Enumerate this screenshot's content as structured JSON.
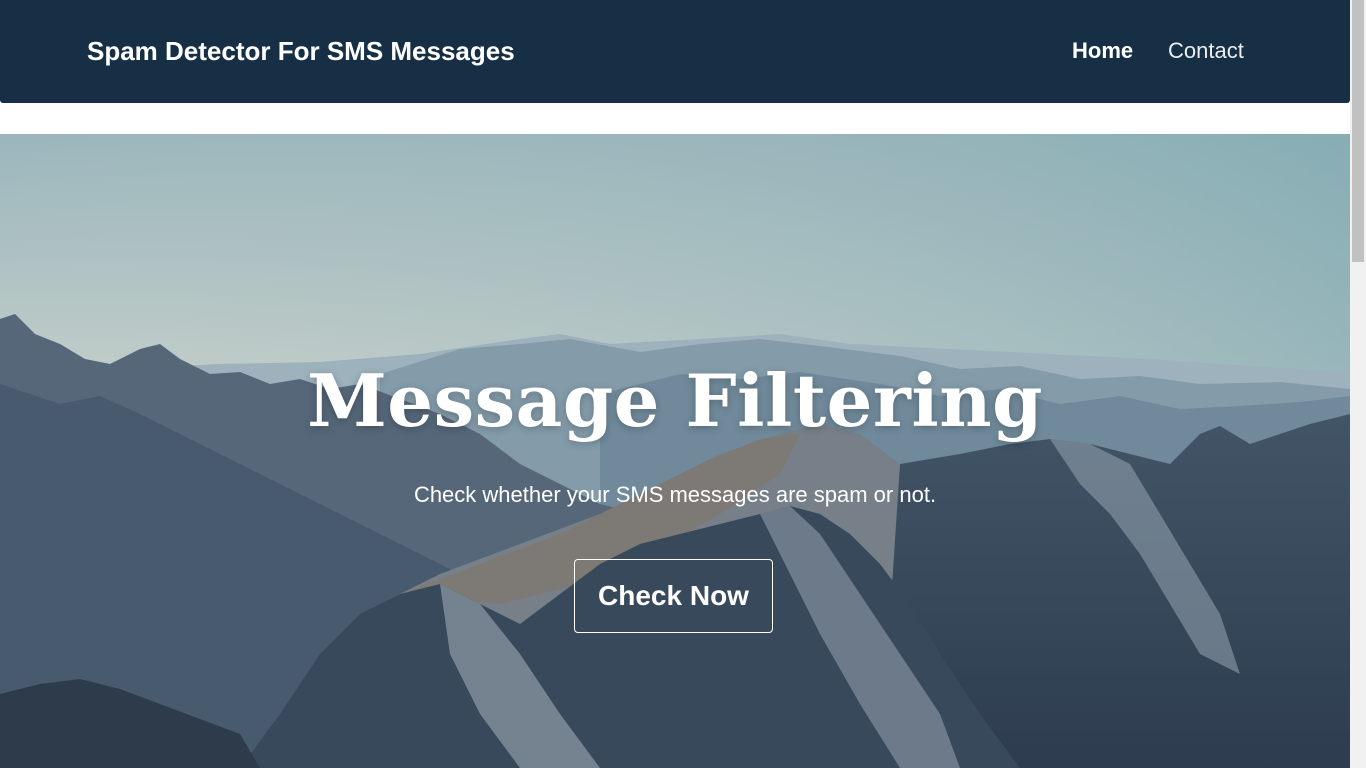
{
  "navbar": {
    "brand": "Spam Detector For SMS Messages",
    "links": [
      {
        "label": "Home",
        "active": true
      },
      {
        "label": "Contact",
        "active": false
      }
    ],
    "background_color": "#162f44"
  },
  "hero": {
    "background_image": "mountain-landscape",
    "title": "Message Filtering",
    "subtitle": "Check whether your SMS messages are spam or not.",
    "button_label": "Check Now"
  }
}
